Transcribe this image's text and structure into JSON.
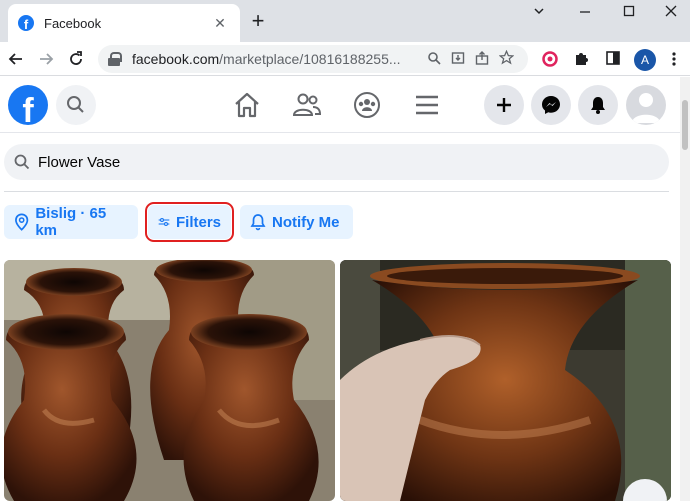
{
  "browser": {
    "tab_title": "Facebook",
    "tab_close": "✕",
    "new_tab": "+",
    "url_host": "facebook.com",
    "url_path": "/marketplace/10816188255...",
    "profile_initial": "A",
    "accent": "#1a56a8"
  },
  "facebook": {
    "logo_letter": "f",
    "brand_color": "#1877f2",
    "nav_icons": [
      "home-icon",
      "friends-icon",
      "groups-icon",
      "menu-icon"
    ],
    "action_icons": [
      "plus-icon",
      "messenger-icon",
      "notifications-icon"
    ]
  },
  "marketplace": {
    "search_value": "Flower Vase",
    "chips": {
      "location": "Bislig · 65 km",
      "filters": "Filters",
      "notify": "Notify Me"
    }
  }
}
